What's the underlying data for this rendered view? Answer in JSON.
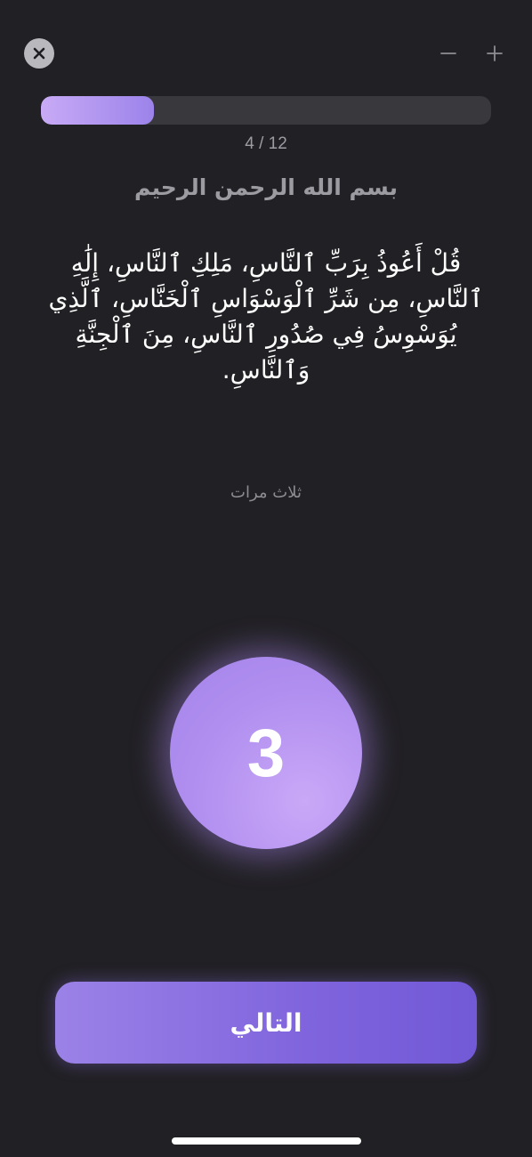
{
  "header": {
    "close_icon": "close-icon",
    "minus_icon": "minus-icon",
    "plus_icon": "plus-icon"
  },
  "progress": {
    "current": 4,
    "total": 12,
    "label": "4 / 12",
    "fill_fraction": 0.25
  },
  "content": {
    "basmala": "بسم الله الرحمن الرحيم",
    "dhikr": "قُلْ أَعُوذُ بِرَبِّ ٱلنَّاسِ، مَلِكِ ٱلنَّاسِ، إِلَٰهِ ٱلنَّاسِ، مِن شَرِّ ٱلْوَسْوَاسِ ٱلْخَنَّاسِ، ٱلَّذِي يُوَسْوِسُ فِي صُدُورِ ٱلنَّاسِ، مِنَ ٱلْجِنَّةِ وَٱلنَّاسِ.",
    "repeat_hint": "ثلاث مرات"
  },
  "counter": {
    "remaining": "3"
  },
  "footer": {
    "next_label": "التالي"
  },
  "colors": {
    "background": "#212024",
    "accent": "#9b82e7",
    "accent_light": "#c8aaf6",
    "track": "#39383d"
  }
}
